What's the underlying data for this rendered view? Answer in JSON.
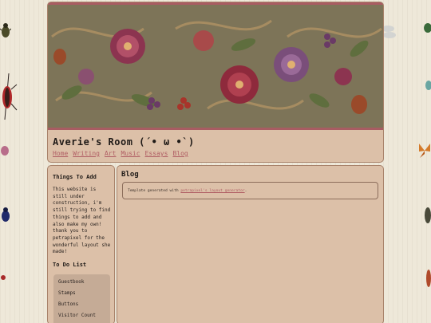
{
  "site": {
    "title": "Averie's Room (´• ω •`)",
    "nav": [
      "Home",
      "Writing",
      "Art",
      "Music",
      "Essays",
      "Blog"
    ]
  },
  "sidebar": {
    "things_heading": "Things To Add",
    "things_text": "This website is still under construction, i'm still trying to find things to add and also make my own! thank you to petrapixel for the wonderful layout she made!",
    "todo_heading": "To Do List",
    "todo_items": [
      "Guestbook",
      "Stamps",
      "Buttons",
      "Visitor Count"
    ]
  },
  "main": {
    "heading": "Blog",
    "template_prefix": "Template generated with ",
    "template_link": "petrapixel's layout generator",
    "template_suffix": "."
  },
  "colors": {
    "page_bg": "#eee8d9",
    "panel_bg": "#dcc0a8",
    "link": "#b05e64",
    "banner_bg": "#7d7458"
  },
  "icons": [
    "bug-icon",
    "beetle-icon",
    "butterfly-icon",
    "moth-icon",
    "dragonfly-icon"
  ]
}
